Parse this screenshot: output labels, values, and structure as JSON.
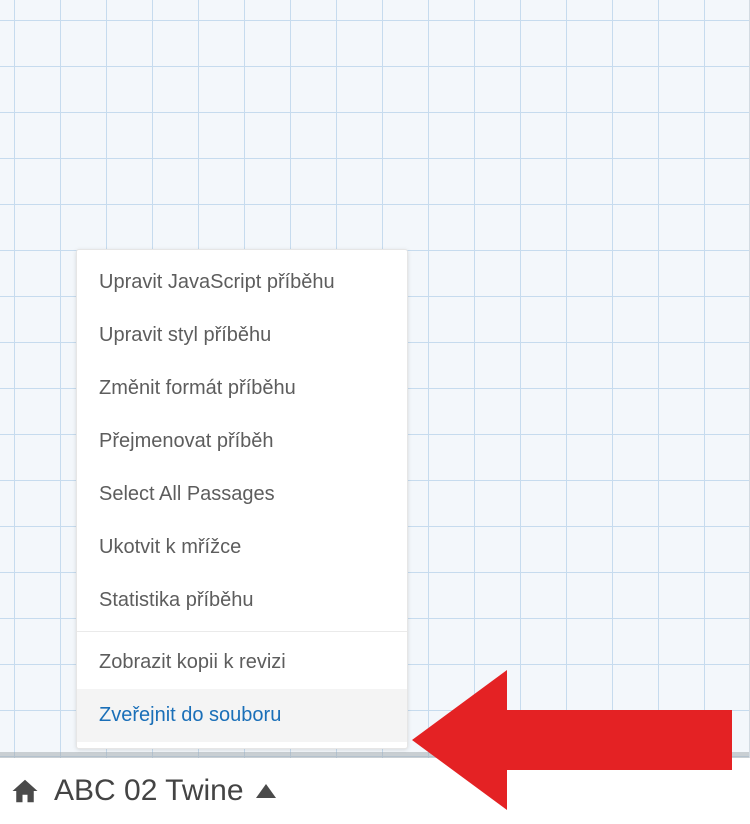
{
  "story": {
    "title": "ABC 02 Twine"
  },
  "menu": {
    "items": [
      "Upravit JavaScript příběhu",
      "Upravit styl příběhu",
      "Změnit formát příběhu",
      "Přejmenovat příběh",
      "Select All Passages",
      "Ukotvit k mřížce",
      "Statistika příběhu"
    ],
    "after_divider": [
      "Zobrazit kopii k revizi",
      "Zveřejnit do souboru"
    ],
    "highlighted": "Zveřejnit do souboru"
  },
  "colors": {
    "highlight_text": "#1a6fb8",
    "arrow": "#e42224"
  }
}
